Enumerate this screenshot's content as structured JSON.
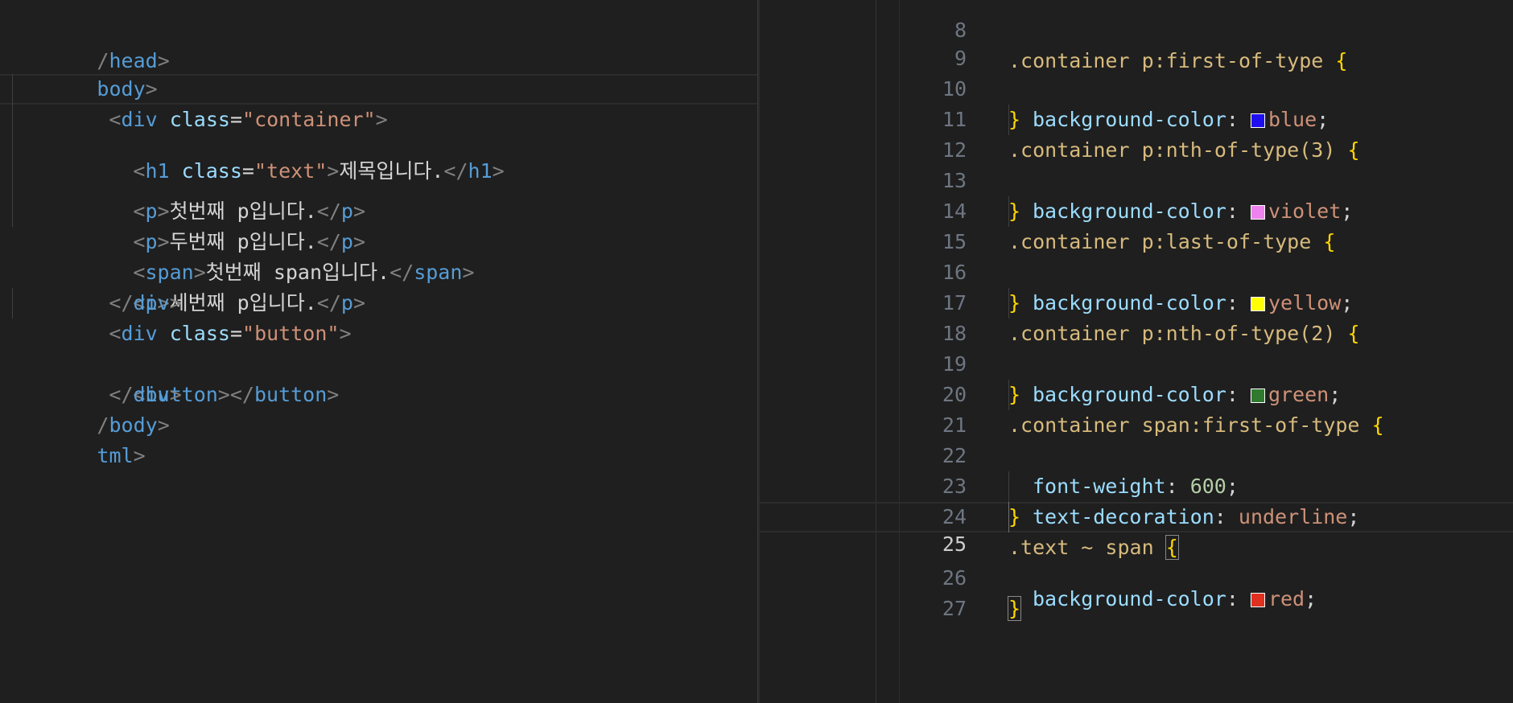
{
  "colors": {
    "background": "#1f1f1f",
    "tag": "#569cd6",
    "attribute": "#9cdcfe",
    "string": "#ce9178",
    "selector": "#d7ba7d",
    "brace": "#ffd700",
    "number": "#b5cea8"
  },
  "left_editor": {
    "lines": [
      {
        "pre": "/",
        "tag": "head",
        "post": ">",
        "text": ""
      },
      {
        "tag": "body",
        "text": ""
      },
      {
        "tag": "div",
        "attr": "class",
        "value": "\"container\""
      },
      {
        "tag": "h1",
        "attr": "class",
        "value": "\"text\"",
        "text": "제목입니다.",
        "close": "h1"
      },
      {
        "tag": "p",
        "text": "첫번째 p입니다.",
        "close": "p"
      },
      {
        "tag": "p",
        "text": "두번째 p입니다.",
        "close": "p"
      },
      {
        "tag": "span",
        "text": "첫번째 span입니다.",
        "close": "span"
      },
      {
        "tag": "p",
        "text": "세번째 p입니다.",
        "close": "p"
      },
      {
        "close": "div"
      },
      {
        "tag": "div",
        "attr": "class",
        "value": "\"button\""
      },
      {
        "tag": "button",
        "close": "button"
      },
      {
        "close": "div"
      },
      {
        "close": "body"
      },
      {
        "close": "tml"
      }
    ]
  },
  "right_editor": {
    "current_line": "25",
    "lines": [
      {
        "num": "8",
        "selector": ".container p:first-of-type",
        "brace": "{"
      },
      {
        "num": "9",
        "prop": "background-color",
        "swatch": "#1f0ff0",
        "value": "blue"
      },
      {
        "num": "10",
        "brace": "}"
      },
      {
        "num": "11",
        "selector": ".container p:nth-of-type(3)",
        "brace": "{"
      },
      {
        "num": "12",
        "prop": "background-color",
        "swatch": "#ee82ee",
        "value": "violet"
      },
      {
        "num": "13",
        "brace": "}"
      },
      {
        "num": "14",
        "selector": ".container p:last-of-type",
        "brace": "{"
      },
      {
        "num": "15",
        "prop": "background-color",
        "swatch": "#ffff00",
        "value": "yellow"
      },
      {
        "num": "16",
        "brace": "}"
      },
      {
        "num": "17",
        "selector": ".container p:nth-of-type(2)",
        "brace": "{"
      },
      {
        "num": "18",
        "prop": "background-color",
        "swatch": "#2f7a2f",
        "value": "green"
      },
      {
        "num": "19",
        "brace": "}"
      },
      {
        "num": "20",
        "selector": ".container span:first-of-type",
        "brace": "{"
      },
      {
        "num": "21",
        "prop": "font-weight",
        "value": "600"
      },
      {
        "num": "22",
        "prop": "text-decoration",
        "value": "underline"
      },
      {
        "num": "23",
        "brace": "}"
      },
      {
        "num": "24",
        "selector": ".text ~ span",
        "brace": "{"
      },
      {
        "num": "25",
        "prop": "background-color",
        "swatch": "#e03020",
        "value": "red"
      },
      {
        "num": "26",
        "brace": "}"
      },
      {
        "num": "27"
      }
    ]
  },
  "text": {
    "lt": "<",
    "gt": ">",
    "slash": "</",
    "eq": "=",
    "colon": ": ",
    "semi": ";"
  }
}
